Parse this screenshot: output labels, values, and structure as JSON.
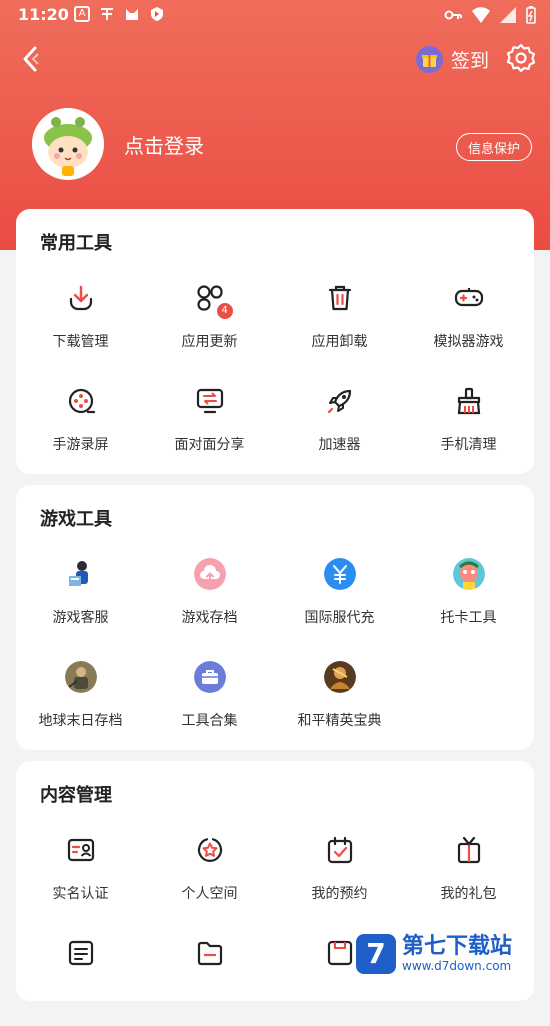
{
  "status_bar": {
    "time": "11:20"
  },
  "header": {
    "checkin_label": "签到"
  },
  "profile": {
    "login_text": "点击登录",
    "privacy_label": "信息保护"
  },
  "sections": [
    {
      "title": "常用工具",
      "items": [
        {
          "label": "下载管理",
          "icon": "download-icon"
        },
        {
          "label": "应用更新",
          "icon": "app-update-icon",
          "badge": "4"
        },
        {
          "label": "应用卸载",
          "icon": "trash-icon"
        },
        {
          "label": "模拟器游戏",
          "icon": "gamepad-icon"
        },
        {
          "label": "手游录屏",
          "icon": "record-icon"
        },
        {
          "label": "面对面分享",
          "icon": "share-screen-icon"
        },
        {
          "label": "加速器",
          "icon": "rocket-icon"
        },
        {
          "label": "手机清理",
          "icon": "broom-icon"
        }
      ]
    },
    {
      "title": "游戏工具",
      "items": [
        {
          "label": "游戏客服",
          "icon": "customer-service-icon"
        },
        {
          "label": "游戏存档",
          "icon": "cloud-upload-icon"
        },
        {
          "label": "国际服代充",
          "icon": "yuan-icon"
        },
        {
          "label": "托卡工具",
          "icon": "toca-icon"
        },
        {
          "label": "地球末日存档",
          "icon": "earth-doomsday-icon"
        },
        {
          "label": "工具合集",
          "icon": "toolbox-icon"
        },
        {
          "label": "和平精英宝典",
          "icon": "peace-elite-icon"
        }
      ]
    },
    {
      "title": "内容管理",
      "items": [
        {
          "label": "实名认证",
          "icon": "id-card-icon"
        },
        {
          "label": "个人空间",
          "icon": "star-circle-icon"
        },
        {
          "label": "我的预约",
          "icon": "calendar-check-icon"
        },
        {
          "label": "我的礼包",
          "icon": "gift-box-icon"
        }
      ]
    }
  ],
  "watermark": {
    "main": "第七下载站",
    "sub": "www.d7down.com",
    "logo_letter": "7"
  },
  "colors": {
    "accent": "#ec4d45",
    "header_top": "#f06d5b",
    "header_bottom": "#ea4c44"
  }
}
